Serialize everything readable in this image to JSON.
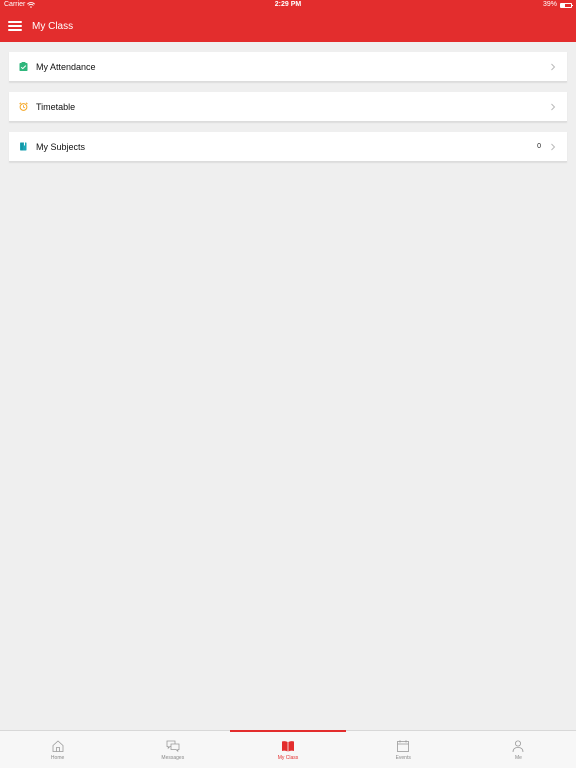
{
  "status_bar": {
    "carrier": "Carrier",
    "time": "2:29 PM",
    "battery_text": "39%",
    "battery_level": 0.39
  },
  "header": {
    "title": "My Class"
  },
  "list": {
    "items": [
      {
        "label": "My Attendance",
        "icon": "attendance-check-icon",
        "icon_color": "#2fb67c"
      },
      {
        "label": "Timetable",
        "icon": "alarm-clock-icon",
        "icon_color": "#f5a623"
      },
      {
        "label": "My Subjects",
        "icon": "book-icon",
        "icon_color": "#1aa6b7",
        "count": "0"
      }
    ]
  },
  "tabs": [
    {
      "label": "Home",
      "icon": "home-icon",
      "active": false
    },
    {
      "label": "Messages",
      "icon": "messages-icon",
      "active": false
    },
    {
      "label": "My Class",
      "icon": "open-book-icon",
      "active": true
    },
    {
      "label": "Events",
      "icon": "calendar-icon",
      "active": false
    },
    {
      "label": "Me",
      "icon": "person-icon",
      "active": false
    }
  ],
  "colors": {
    "accent": "#e32d2d",
    "background": "#efefef",
    "tab_inactive": "#888888"
  }
}
